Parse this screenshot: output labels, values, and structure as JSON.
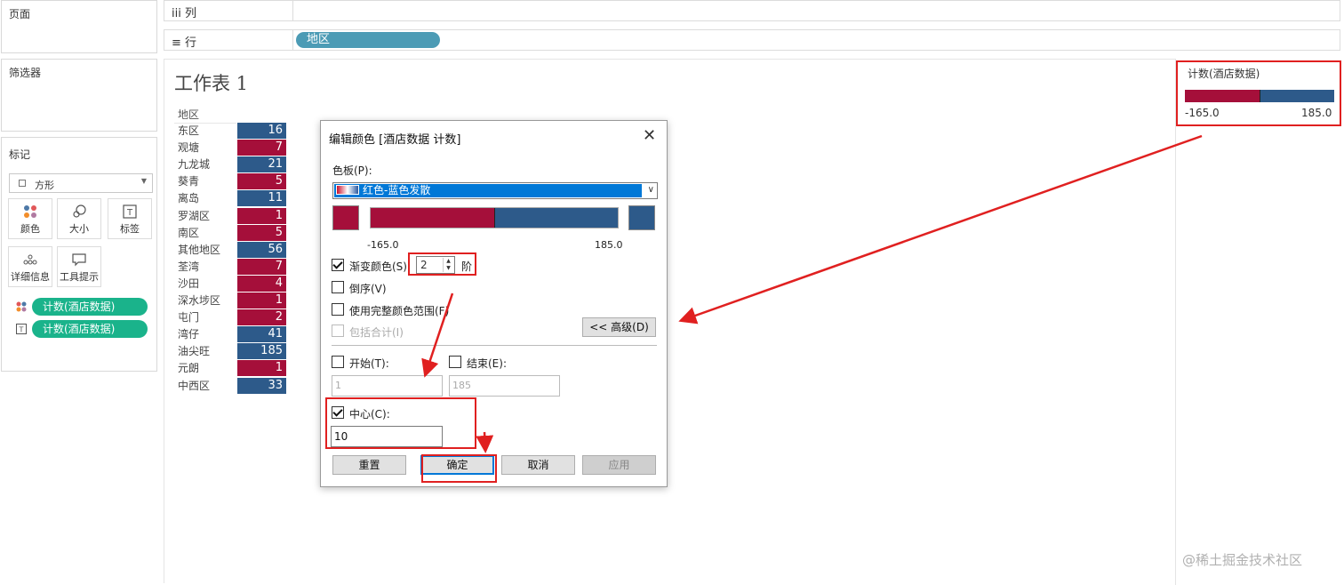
{
  "shelves": {
    "pages_label": "页面",
    "columns_label": "iii 列",
    "rows_label": "≡ 行",
    "rows_pill": "地区"
  },
  "filters": {
    "title": "筛选器"
  },
  "marks": {
    "title": "标记",
    "mark_type": "方形",
    "buttons": [
      {
        "label": "颜色",
        "icon": "color-dots-icon"
      },
      {
        "label": "大小",
        "icon": "size-icon"
      },
      {
        "label": "标签",
        "icon": "label-icon"
      },
      {
        "label": "详细信息",
        "icon": "detail-dots-icon"
      },
      {
        "label": "工具提示",
        "icon": "tooltip-icon"
      }
    ],
    "pills": [
      "计数(酒店数据)",
      "计数(酒店数据)"
    ]
  },
  "worksheet": {
    "title": "工作表 1",
    "column_header": "地区",
    "rows": [
      {
        "region": "东区",
        "value": "16"
      },
      {
        "region": "观塘",
        "value": "7"
      },
      {
        "region": "九龙城",
        "value": "21"
      },
      {
        "region": "葵青",
        "value": "5"
      },
      {
        "region": "离岛",
        "value": "11"
      },
      {
        "region": "罗湖区",
        "value": "1"
      },
      {
        "region": "南区",
        "value": "5"
      },
      {
        "region": "其他地区",
        "value": "56"
      },
      {
        "region": "荃湾",
        "value": "7"
      },
      {
        "region": "沙田",
        "value": "4"
      },
      {
        "region": "深水埗区",
        "value": "1"
      },
      {
        "region": "屯门",
        "value": "2"
      },
      {
        "region": "湾仔",
        "value": "41"
      },
      {
        "region": "油尖旺",
        "value": "185"
      },
      {
        "region": "元朗",
        "value": "1"
      },
      {
        "region": "中西区",
        "value": "33"
      }
    ]
  },
  "legend": {
    "title": "计数(酒店数据)",
    "min": "-165.0",
    "max": "185.0"
  },
  "dialog": {
    "title": "编辑颜色 [酒店数据 计数]",
    "close": "✕",
    "palette_label": "色板(P):",
    "palette_value": "红色-蓝色发散",
    "bar_min": "-165.0",
    "bar_max": "185.0",
    "stepped_label": "渐变颜色(S)",
    "stepped_value": "2",
    "stepped_unit": "阶",
    "reversed_label": "倒序(V)",
    "full_range_label": "使用完整颜色范围(F)",
    "include_totals_label": "包括合计(I)",
    "advanced_button": "<< 高级(D)",
    "start_label": "开始(T):",
    "start_value": "1",
    "end_label": "结束(E):",
    "end_value": "185",
    "center_label": "中心(C):",
    "center_value": "10",
    "reset_button": "重置",
    "ok_button": "确定",
    "cancel_button": "取消",
    "apply_button": "应用"
  },
  "watermark": "@稀土掘金技术社区",
  "colors": {
    "red": "#a50f3a",
    "blue": "#2d5a8a",
    "pill_green": "#1ab38b",
    "shelf_pill": "#4c9bb5",
    "callout": "#e02020"
  }
}
